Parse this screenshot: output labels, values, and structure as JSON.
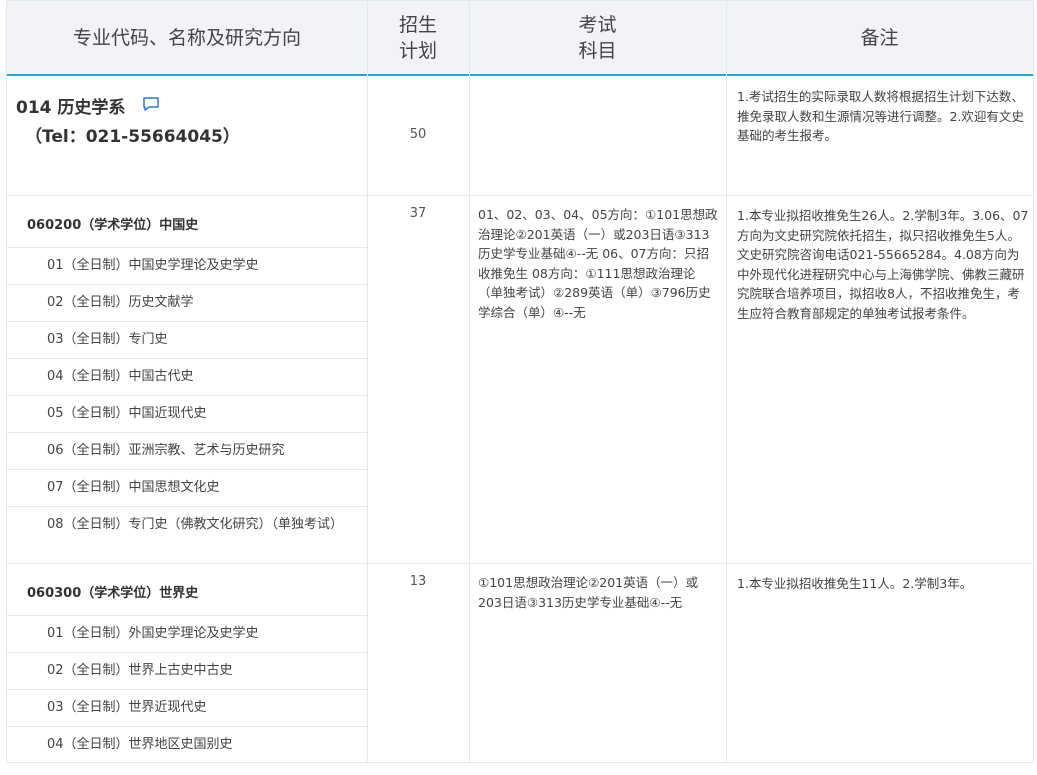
{
  "header": {
    "col1": "专业代码、名称及研究方向",
    "col2_line1": "招生",
    "col2_line2": "计划",
    "col3_line1": "考试",
    "col3_line2": "科目",
    "col4": "备注"
  },
  "department": {
    "name": "014 历史学系",
    "tel": "（Tel：021-55664045）",
    "plan": "50",
    "notes": "1.考试招生的实际录取人数将根据招生计划下达数、推免录取人数和生源情况等进行调整。2.欢迎有文史基础的考生报考。"
  },
  "majors": [
    {
      "title": "060200（学术学位）中国史",
      "plan": "37",
      "exam": "01、02、03、04、05方向：①101思想政治理论②201英语（一）或203日语③313历史学专业基础④--无 06、07方向：只招收推免生 08方向：①111思想政治理论（单独考试）②289英语（单）③796历史学综合（单）④--无",
      "notes": "1.本专业拟招收推免生26人。2.学制3年。3.06、07方向为文史研究院依托招生，拟只招收推免生5人。文史研究院咨询电话021-55665284。4.08方向为中外现代化进程研究中心与上海佛学院、佛教三藏研究院联合培养项目，拟招收8人，不招收推免生，考生应符合教育部规定的单独考试报考条件。",
      "directions": [
        "01（全日制）中国史学理论及史学史",
        "02（全日制）历史文献学",
        "03（全日制）专门史",
        "04（全日制）中国古代史",
        "05（全日制）中国近现代史",
        "06（全日制）亚洲宗教、艺术与历史研究",
        "07（全日制）中国思想文化史",
        "08（全日制）专门史（佛教文化研究）（单独考试）"
      ]
    },
    {
      "title": "060300（学术学位）世界史",
      "plan": "13",
      "exam": "①101思想政治理论②201英语（一）或203日语③313历史学专业基础④--无",
      "notes": "1.本专业拟招收推免生11人。2.学制3年。",
      "directions": [
        "01（全日制）外国史学理论及史学史",
        "02（全日制）世界上古史中古史",
        "03（全日制）世界近现代史",
        "04（全日制）世界地区史国别史"
      ]
    }
  ]
}
